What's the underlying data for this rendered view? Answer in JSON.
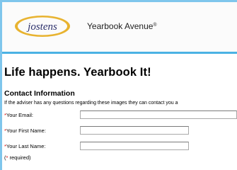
{
  "header": {
    "logo_text": "jostens",
    "brand_text": "Yearbook Avenue",
    "brand_mark": "®"
  },
  "main": {
    "headline": "Life happens. Yearbook It!",
    "section_title": "Contact Information",
    "description": "If the adviser has any questions regarding these images they can contact you a",
    "fields": [
      {
        "star": "*",
        "label": "Your Email:",
        "value": ""
      },
      {
        "star": "*",
        "label": "Your First Name:",
        "value": ""
      },
      {
        "star": "*",
        "label": "Your Last Name:",
        "value": ""
      }
    ],
    "required_note": {
      "open": "(",
      "star": "*",
      "text": " required)"
    }
  },
  "colors": {
    "frame_blue": "#7fc6ec",
    "header_rule": "#4bb2e4",
    "logo_gold": "#e8b330",
    "logo_text": "#2b2f6b",
    "required_star": "#cc0000"
  }
}
